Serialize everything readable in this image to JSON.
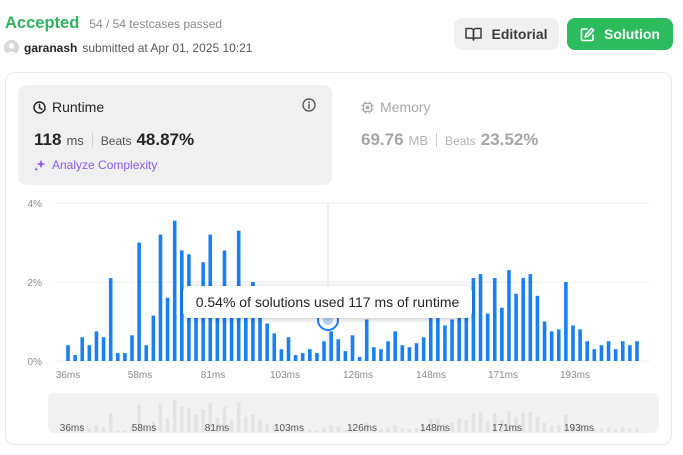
{
  "header": {
    "status": "Accepted",
    "testcases": "54 / 54 testcases passed",
    "username": "garanash",
    "submitted_text": "submitted at Apr 01, 2025 10:21",
    "editorial_label": "Editorial",
    "solution_label": "Solution"
  },
  "runtime": {
    "title": "Runtime",
    "value": "118",
    "unit": "ms",
    "beats_label": "Beats",
    "beats_value": "48.87%",
    "analyze_label": "Analyze Complexity"
  },
  "memory": {
    "title": "Memory",
    "value": "69.76",
    "unit": "MB",
    "beats_label": "Beats",
    "beats_value": "23.52%"
  },
  "tooltip": {
    "text": "0.54% of solutions used 117 ms of runtime"
  },
  "colors": {
    "accent": "#2cbb5d",
    "bar": "#1a7ff5",
    "bar_faint": "#e3e3e3",
    "analyze": "#8c5cf0"
  },
  "chart_data": {
    "type": "bar",
    "ylabel": "",
    "yticks": [
      "0%",
      "2%",
      "4%"
    ],
    "ylim": [
      0,
      4
    ],
    "xticks": [
      "36ms",
      "58ms",
      "81ms",
      "103ms",
      "126ms",
      "148ms",
      "171ms",
      "193ms"
    ],
    "values": [
      0.4,
      0.15,
      0.6,
      0.4,
      0.75,
      0.6,
      2.1,
      0.2,
      0.2,
      0.65,
      3.0,
      0.4,
      1.15,
      3.2,
      1.6,
      3.55,
      2.8,
      2.7,
      1.9,
      2.5,
      3.2,
      1.6,
      2.8,
      1.3,
      3.3,
      1.7,
      2.0,
      1.4,
      0.95,
      0.7,
      0.3,
      0.6,
      0.15,
      0.2,
      0.3,
      0.2,
      0.5,
      0.75,
      0.55,
      0.25,
      0.65,
      0.1,
      1.05,
      0.35,
      0.3,
      0.5,
      0.75,
      0.4,
      0.35,
      0.45,
      0.6,
      1.5,
      1.4,
      0.9,
      1.05,
      1.5,
      1.3,
      2.1,
      2.2,
      1.2,
      2.1,
      1.35,
      2.3,
      1.7,
      2.1,
      2.2,
      1.65,
      1.0,
      0.75,
      0.8,
      2.0,
      0.9,
      0.8,
      0.5,
      0.3,
      0.4,
      0.5,
      0.3,
      0.5,
      0.4,
      0.5
    ],
    "highlight_value_ms": 117
  }
}
